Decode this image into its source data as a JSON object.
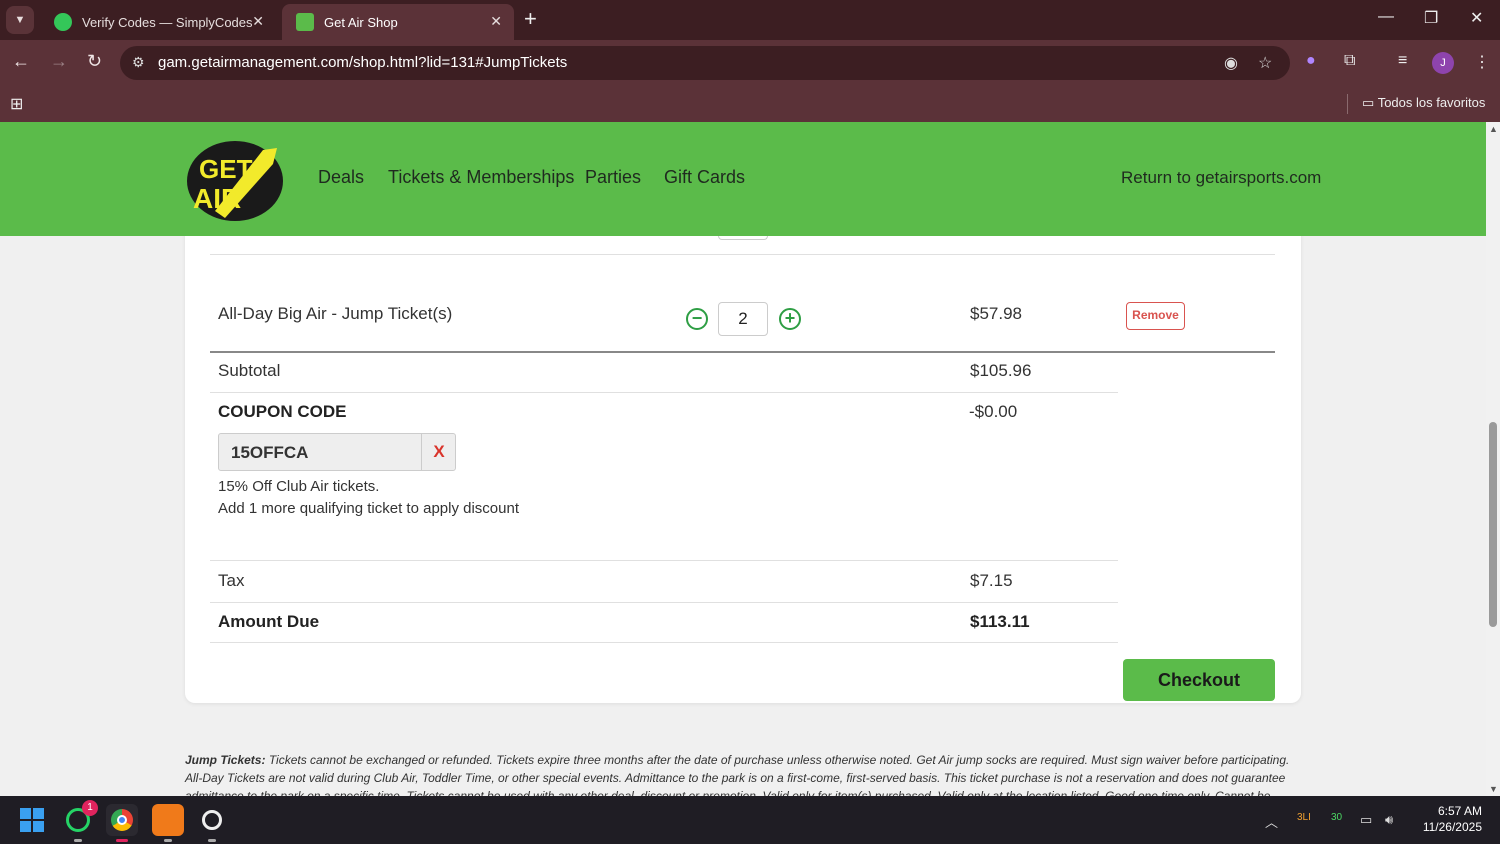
{
  "browser": {
    "tabs": [
      {
        "title": "Verify Codes — SimplyCodes",
        "favicon_color": "#34c759"
      },
      {
        "title": "Get Air Shop",
        "favicon_color": "#5bbb4a"
      }
    ],
    "url": "gam.getairmanagement.com/shop.html?lid=131#JumpTickets",
    "bookmarks_folder": "Todos los favoritos",
    "profile_initial": "J"
  },
  "site": {
    "brand_colors": {
      "header": "#5bbb4a",
      "accent": "#2e9e44"
    },
    "logo_text_top": "GET",
    "logo_text_bottom": "AIR",
    "nav": [
      "Deals",
      "Tickets & Memberships",
      "Parties",
      "Gift Cards"
    ],
    "return_link": "Return to getairsports.com"
  },
  "cart": {
    "item": {
      "name": "All-Day Big Air - Jump Ticket(s)",
      "quantity": "2",
      "price": "$57.98",
      "remove_label": "Remove"
    },
    "subtotal_label": "Subtotal",
    "subtotal": "$105.96",
    "coupon_label": "COUPON CODE",
    "coupon_discount": "-$0.00",
    "coupon_code": "15OFFCA",
    "coupon_clear": "X",
    "coupon_desc": "15% Off Club Air tickets.",
    "coupon_note": "Add 1 more qualifying ticket to apply discount",
    "tax_label": "Tax",
    "tax": "$7.15",
    "amount_due_label": "Amount Due",
    "amount_due": "$113.11",
    "checkout_label": "Checkout"
  },
  "terms": {
    "heading": "Jump Tickets:",
    "text": " Tickets cannot be exchanged or refunded. Tickets expire three months after the date of purchase unless otherwise noted. Get Air jump socks are required. Must sign waiver before participating. All-Day Tickets are not valid during Club Air, Toddler Time, or other special events. Admittance to the park is on a first-come, first-served basis. This ticket purchase is not a reservation and does not guarantee admittance to the park on a specific time. Tickets cannot be used with any other deal, discount or promotion. Valid only for item(s) purchased. Valid only at the location listed. Good one time only. Cannot be replaced if lost or stolen."
  },
  "taskbar": {
    "whatsapp_badge": "1",
    "tray_1": "3LI",
    "tray_2": "30",
    "time": "6:57 AM",
    "date": "11/26/2025"
  }
}
